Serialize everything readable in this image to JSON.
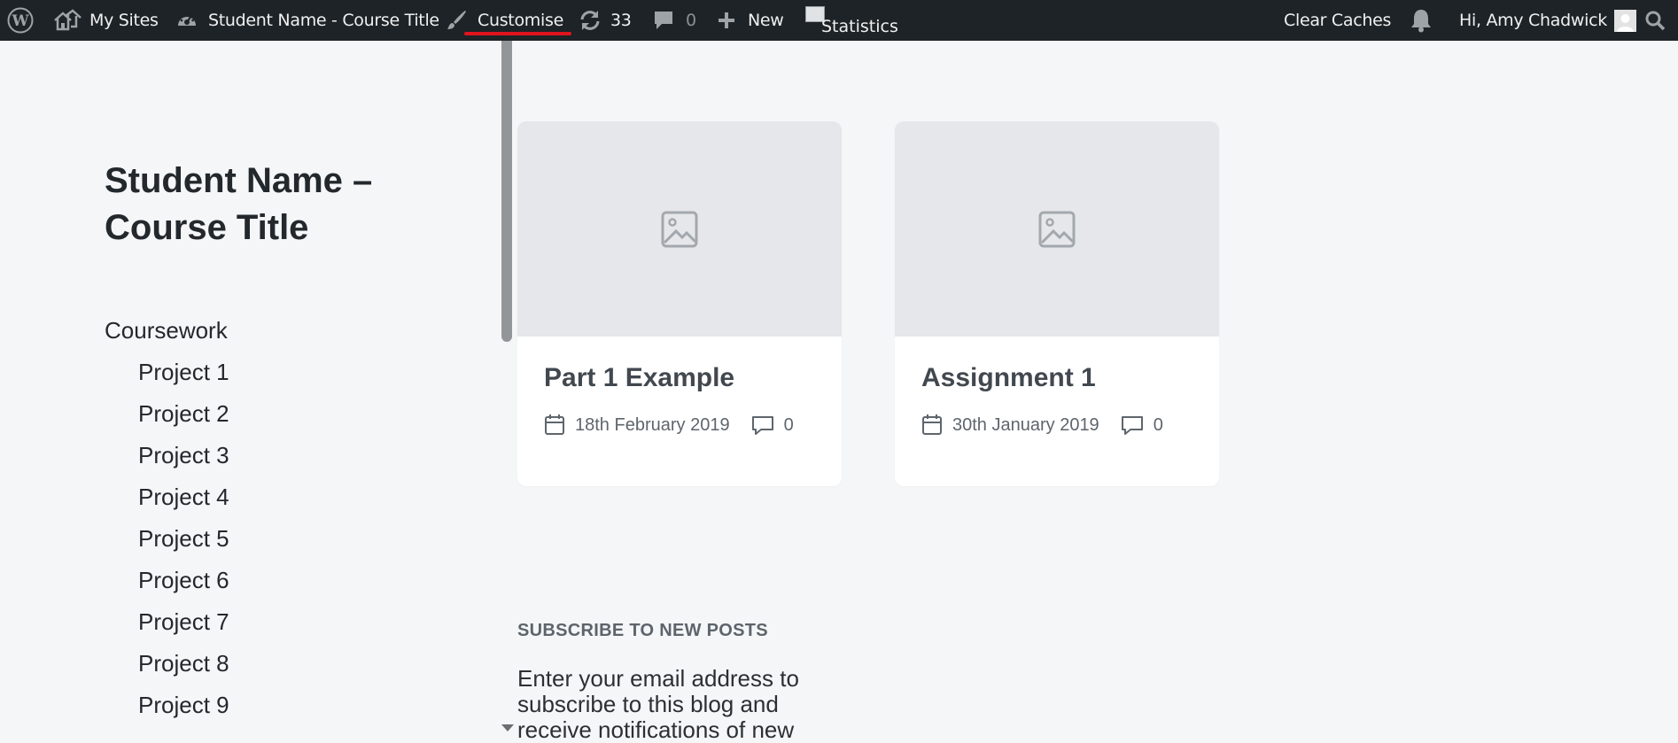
{
  "adminbar": {
    "my_sites": "My Sites",
    "site_name": "Student Name - Course Title",
    "customise": "Customise",
    "updates_count": "33",
    "comments_count": "0",
    "new": "New",
    "statistics_alt": "Statistics",
    "clear_caches": "Clear Caches",
    "greeting": "Hi, Amy Chadwick",
    "icons": [
      "wordpress-logo",
      "my-sites-icon",
      "dashboard-icon",
      "brush-icon",
      "refresh-icon",
      "comment-icon",
      "plus-icon",
      "bell-icon",
      "avatar",
      "search-icon"
    ],
    "highlight_color": "#e0141e"
  },
  "sidebar": {
    "site_title": "Student Name – Course Title",
    "menu": {
      "top": "Coursework",
      "items": [
        "Project 1",
        "Project 2",
        "Project 3",
        "Project 4",
        "Project 5",
        "Project 6",
        "Project 7",
        "Project 8",
        "Project 9"
      ]
    }
  },
  "posts": [
    {
      "title": "Part 1 Example",
      "date": "18th February 2019",
      "comments": "0"
    },
    {
      "title": "Assignment 1",
      "date": "30th January 2019",
      "comments": "0"
    }
  ],
  "subscribe": {
    "heading": "SUBSCRIBE TO NEW POSTS",
    "text": "Enter your email address to subscribe to this blog and receive notifications of new"
  }
}
